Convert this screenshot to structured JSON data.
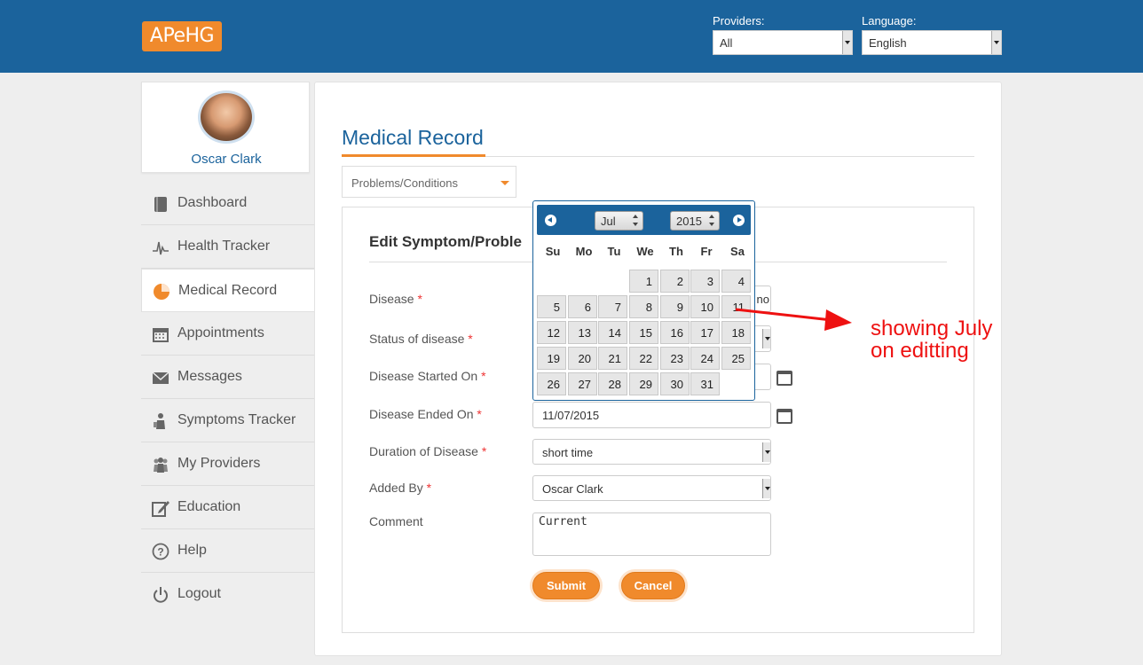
{
  "header": {
    "logo": "APeHG",
    "providers_label": "Providers:",
    "providers_value": "All",
    "language_label": "Language:",
    "language_value": "English",
    "bg_color": "#1b639c",
    "accent_color": "#f08a2c"
  },
  "profile": {
    "name": "Oscar Clark"
  },
  "sidebar": {
    "items": [
      {
        "label": "Dashboard",
        "icon": "book-icon"
      },
      {
        "label": "Health Tracker",
        "icon": "heartbeat-icon"
      },
      {
        "label": "Medical Record",
        "icon": "pie-chart-icon",
        "active": true
      },
      {
        "label": "Appointments",
        "icon": "calendar-icon"
      },
      {
        "label": "Messages",
        "icon": "envelope-icon"
      },
      {
        "label": "Symptoms Tracker",
        "icon": "person-icon"
      },
      {
        "label": "My Providers",
        "icon": "group-icon"
      },
      {
        "label": "Education",
        "icon": "edit-icon"
      },
      {
        "label": "Help",
        "icon": "question-icon"
      },
      {
        "label": "Logout",
        "icon": "power-icon"
      }
    ]
  },
  "main": {
    "title": "Medical Record",
    "category_select": "Problems/Conditions",
    "form_title": "Edit Symptom/Proble",
    "fields": {
      "disease": {
        "label": "Disease",
        "value": "no"
      },
      "status": {
        "label": "Status of disease"
      },
      "started": {
        "label": "Disease Started On"
      },
      "ended": {
        "label": "Disease Ended On",
        "value": "11/07/2015"
      },
      "duration": {
        "label": "Duration of Disease",
        "value": "short time"
      },
      "added_by": {
        "label": "Added By",
        "value": "Oscar Clark"
      },
      "comment": {
        "label": "Comment",
        "value": "Current"
      }
    },
    "required_marker": "*",
    "submit_label": "Submit",
    "cancel_label": "Cancel"
  },
  "datepicker": {
    "month": "Jul",
    "year": "2015",
    "weekdays": [
      "Su",
      "Mo",
      "Tu",
      "We",
      "Th",
      "Fr",
      "Sa"
    ],
    "first_weekday_index": 3,
    "days_in_month": 31
  },
  "annotation": {
    "line1": "showing July",
    "line2": "on editting",
    "color": "#ee1111"
  }
}
